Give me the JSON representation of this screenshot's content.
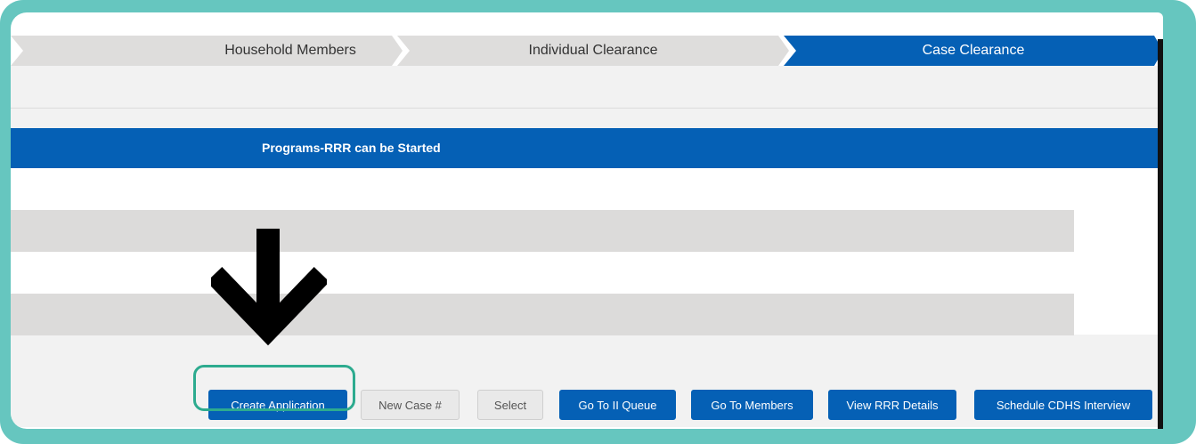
{
  "steps": {
    "household_members": "Household Members",
    "individual_clearance": "Individual Clearance",
    "case_clearance": "Case Clearance"
  },
  "banner": {
    "title": "Programs-RRR can be Started"
  },
  "buttons": {
    "create_application": "Create Application",
    "new_case": "New Case #",
    "select": "Select",
    "go_to_ii_queue": "Go To II Queue",
    "go_to_members": "Go To Members",
    "view_rrr_details": "View RRR Details",
    "schedule_cdhs_interview": "Schedule CDHS Interview"
  },
  "colors": {
    "frame": "#66c6bf",
    "primary": "#0560b5",
    "highlight": "#2dab8f"
  }
}
